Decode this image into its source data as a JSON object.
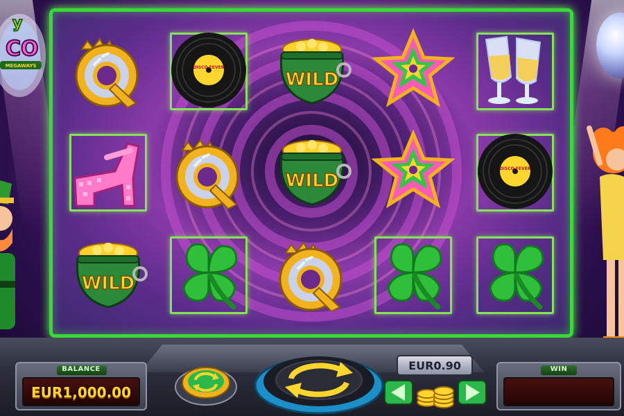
{
  "game": {
    "logo_text_top": "y",
    "logo_text_mid": "CO",
    "logo_text_sub": "MEGAWAYS"
  },
  "reels": {
    "grid": [
      [
        "queen",
        "vinyl-record",
        "pot-of-gold-wild",
        "star",
        "champagne"
      ],
      [
        "pink-platform-shoe",
        "queen",
        "pot-of-gold-wild",
        "star",
        "vinyl-record"
      ],
      [
        "pot-of-gold-wild",
        "clover",
        "queen",
        "clover",
        "clover"
      ]
    ],
    "wild_label": "WILD",
    "record_label": "DISCO FEVER"
  },
  "console": {
    "balance_label": "BALANCE",
    "balance_value": "EUR1,000.00",
    "bet_value": "EUR0.90",
    "win_label": "WIN",
    "win_value": ""
  },
  "colors": {
    "frame_green": "#39d936",
    "gold": "#ffd52e",
    "readout_bg": "#230404"
  },
  "icons": {
    "autoplay": "autoplay-icon",
    "spin": "spin-arrows-icon",
    "bet_down": "chevron-left-icon",
    "bet_up": "chevron-right-icon",
    "coins": "coin-stack-icon"
  }
}
